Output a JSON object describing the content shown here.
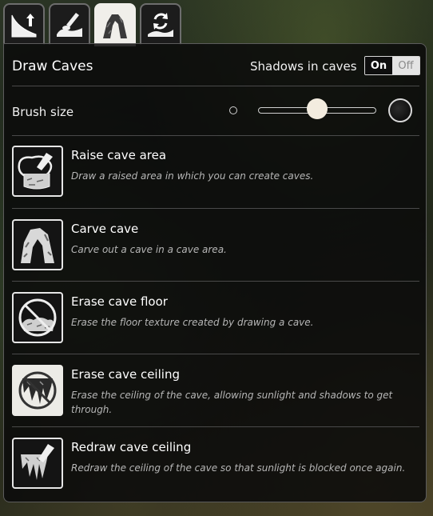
{
  "tabs": [
    {
      "name": "terrain-height-tab",
      "icon": "terrain-height-icon",
      "active": false
    },
    {
      "name": "terrain-paint-tab",
      "icon": "terrain-paint-icon",
      "active": false
    },
    {
      "name": "caves-tab",
      "icon": "cave-icon",
      "active": true
    },
    {
      "name": "terrain-refresh-tab",
      "icon": "terrain-refresh-icon",
      "active": false
    }
  ],
  "header": {
    "title": "Draw Caves",
    "shadows_label": "Shadows in caves",
    "toggle_on": "On",
    "toggle_off": "Off",
    "shadows_state": "on"
  },
  "brush": {
    "label": "Brush size",
    "value_fraction": 0.5
  },
  "tools": [
    {
      "icon": "raise-cave-area-icon",
      "title": "Raise cave area",
      "desc": "Draw a raised area in which you can create caves.",
      "selected": false
    },
    {
      "icon": "carve-cave-icon",
      "title": "Carve cave",
      "desc": "Carve out a cave in a cave area.",
      "selected": false
    },
    {
      "icon": "erase-cave-floor-icon",
      "title": "Erase cave floor",
      "desc": "Erase the floor texture created by drawing a cave.",
      "selected": false
    },
    {
      "icon": "erase-cave-ceiling-icon",
      "title": "Erase cave ceiling",
      "desc": "Erase the ceiling of the cave, allowing sunlight and shadows to get through.",
      "selected": true
    },
    {
      "icon": "redraw-cave-ceiling-icon",
      "title": "Redraw cave ceiling",
      "desc": "Redraw the ceiling of the cave so that sunlight is blocked once again.",
      "selected": false
    }
  ]
}
